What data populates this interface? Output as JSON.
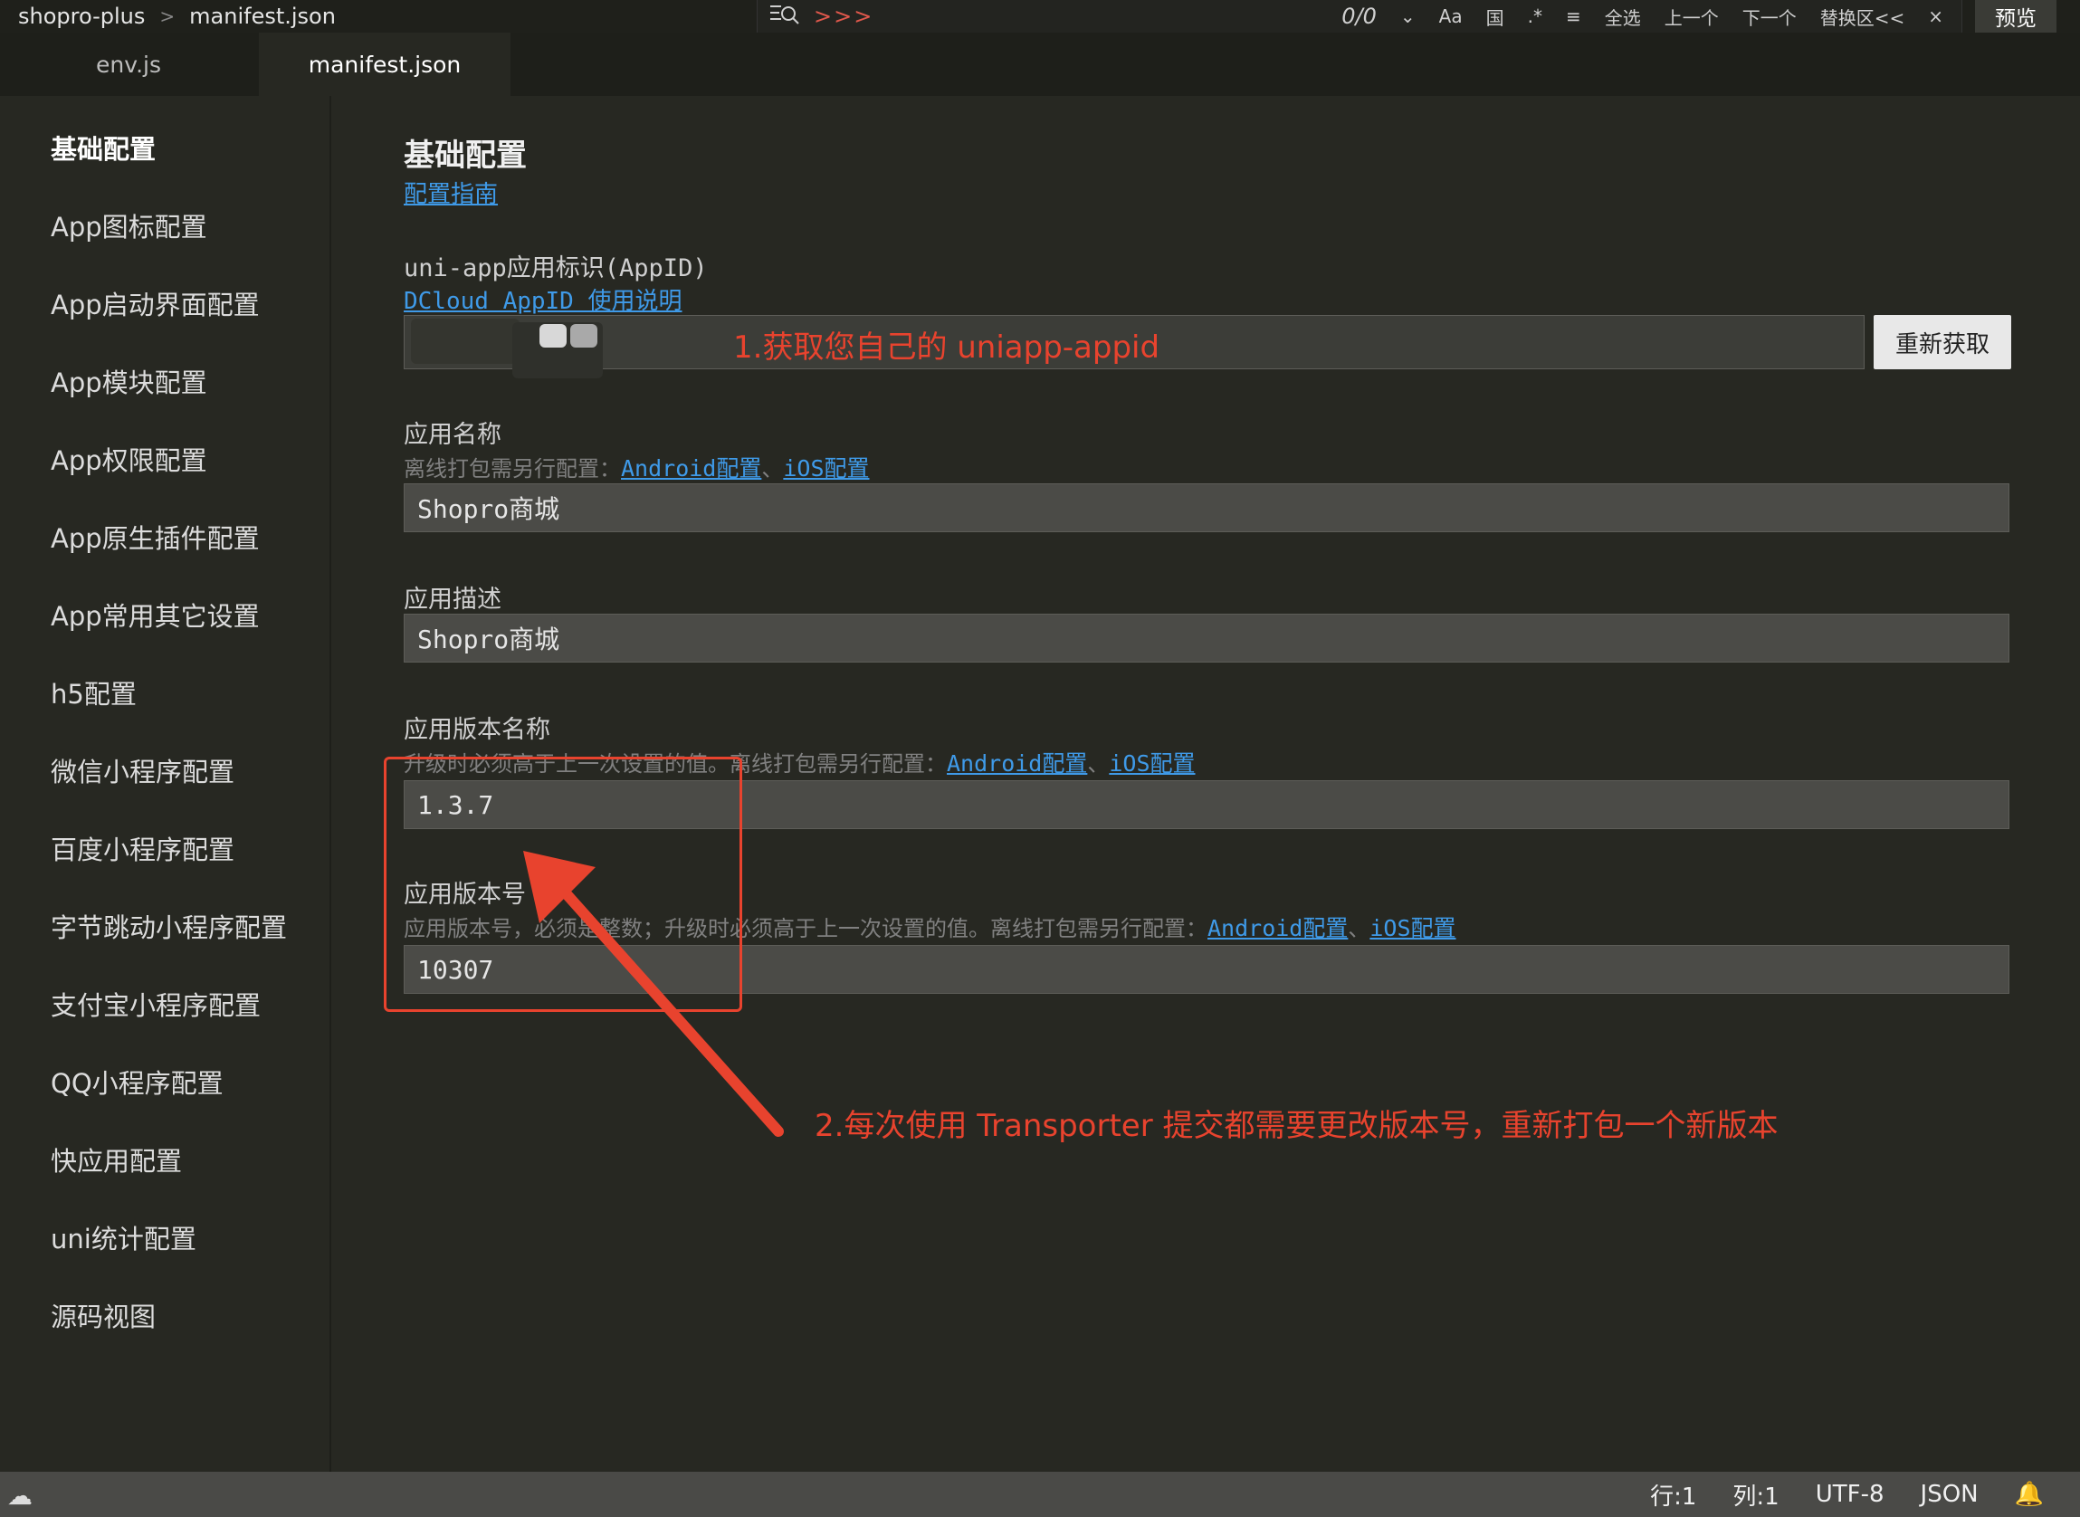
{
  "topbar": {
    "project": "shopro-plus",
    "separator": ">",
    "file": "manifest.json",
    "find_arrows": ">>>",
    "match_count": "0/0",
    "case_toggle": "Aa",
    "word_toggle": "国",
    "regex_toggle": ".*",
    "select_all": "全选",
    "prev": "上一个",
    "next": "下一个",
    "replace_toggle": "替换区<<",
    "close": "×",
    "preview": "预览"
  },
  "tabs": [
    {
      "label": "env.js",
      "active": false
    },
    {
      "label": "manifest.json",
      "active": true
    }
  ],
  "sidebar": {
    "items": [
      "基础配置",
      "App图标配置",
      "App启动界面配置",
      "App模块配置",
      "App权限配置",
      "App原生插件配置",
      "App常用其它设置",
      "h5配置",
      "微信小程序配置",
      "百度小程序配置",
      "字节跳动小程序配置",
      "支付宝小程序配置",
      "QQ小程序配置",
      "快应用配置",
      "uni统计配置",
      "源码视图"
    ]
  },
  "main": {
    "title": "基础配置",
    "guide_link": "配置指南",
    "appid": {
      "label": "uni-app应用标识(AppID)",
      "help_link": "DCloud AppID 使用说明",
      "value": ".",
      "refresh_button": "重新获取"
    },
    "app_name": {
      "label": "应用名称",
      "hint": "离线打包需另行配置：",
      "android_link": "Android配置",
      "sep": "、",
      "ios_link": "iOS配置",
      "value": "Shopro商城"
    },
    "app_desc": {
      "label": "应用描述",
      "value": "Shopro商城"
    },
    "version_name": {
      "label": "应用版本名称",
      "hint": "升级时必须高于上一次设置的值。离线打包需另行配置：",
      "android_link": "Android配置",
      "sep": "、",
      "ios_link": "iOS配置",
      "value": "1.3.7"
    },
    "version_code": {
      "label": "应用版本号",
      "hint": "应用版本号，必须是整数；升级时必须高于上一次设置的值。离线打包需另行配置：",
      "android_link": "Android配置",
      "sep": "、",
      "ios_link": "iOS配置",
      "value": "10307"
    }
  },
  "annotations": {
    "step1": "1.获取您自己的 uniapp-appid",
    "step2": "2.每次使用 Transporter 提交都需要更改版本号，重新打包一个新版本",
    "color": "#e8432e"
  },
  "statusbar": {
    "line": "行:1",
    "col": "列:1",
    "encoding": "UTF-8",
    "language": "JSON"
  }
}
